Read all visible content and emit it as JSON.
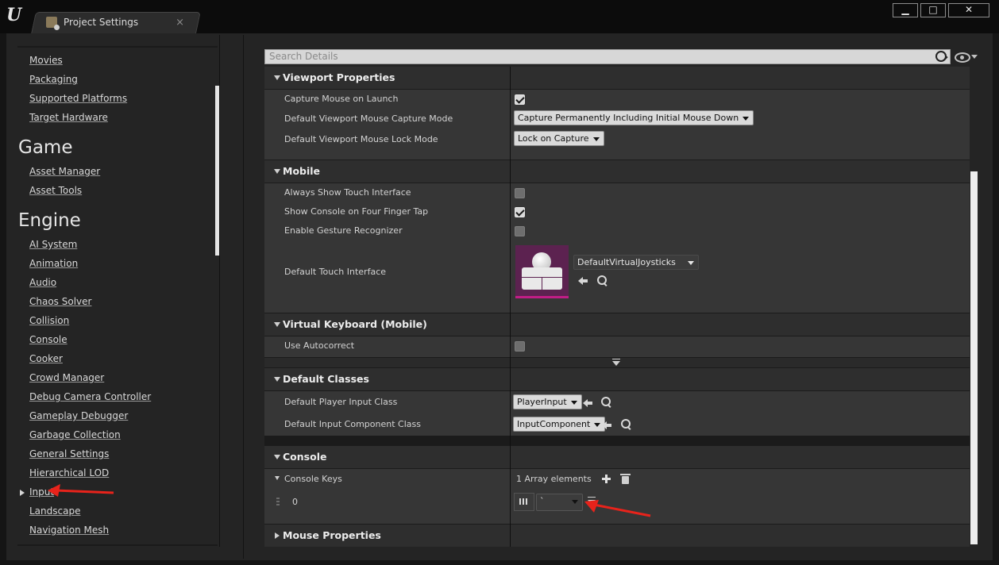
{
  "window": {
    "logo": "U",
    "tab_title": "Project Settings",
    "tab_close": "×",
    "minimize": "▁",
    "maximize": "□",
    "close": "✕"
  },
  "sidebar": {
    "items_top": [
      "Movies",
      "Packaging",
      "Supported Platforms",
      "Target Hardware"
    ],
    "sections": [
      {
        "title": "Game",
        "items": [
          "Asset Manager",
          "Asset Tools"
        ]
      },
      {
        "title": "Engine",
        "items": [
          "AI System",
          "Animation",
          "Audio",
          "Chaos Solver",
          "Collision",
          "Console",
          "Cooker",
          "Crowd Manager",
          "Debug Camera Controller",
          "Gameplay Debugger",
          "Garbage Collection",
          "General Settings",
          "Hierarchical LOD",
          "Input",
          "Landscape",
          "Navigation Mesh"
        ]
      }
    ]
  },
  "search": {
    "placeholder": "Search Details"
  },
  "details": {
    "viewport": {
      "title": "Viewport Properties",
      "capture_mouse_label": "Capture Mouse on Launch",
      "capture_mouse_value": true,
      "capture_mode_label": "Default Viewport Mouse Capture Mode",
      "capture_mode_value": "Capture Permanently Including Initial Mouse Down",
      "lock_mode_label": "Default Viewport Mouse Lock Mode",
      "lock_mode_value": "Lock on Capture"
    },
    "mobile": {
      "title": "Mobile",
      "always_touch_label": "Always Show Touch Interface",
      "always_touch_value": false,
      "four_finger_label": "Show Console on Four Finger Tap",
      "four_finger_value": true,
      "gesture_label": "Enable Gesture Recognizer",
      "gesture_value": false,
      "touch_interface_label": "Default Touch Interface",
      "touch_interface_value": "DefaultVirtualJoysticks"
    },
    "vkb": {
      "title": "Virtual Keyboard (Mobile)",
      "autocorrect_label": "Use Autocorrect",
      "autocorrect_value": false
    },
    "classes": {
      "title": "Default Classes",
      "player_input_label": "Default Player Input Class",
      "player_input_value": "PlayerInput",
      "input_component_label": "Default Input Component Class",
      "input_component_value": "InputComponent"
    },
    "console": {
      "title": "Console",
      "keys_label": "Console Keys",
      "keys_count": "1 Array elements",
      "element_index": "0",
      "element_value": "`"
    },
    "mouse": {
      "title": "Mouse Properties"
    }
  },
  "annotations": {
    "arrow_color": "#e8231b"
  }
}
